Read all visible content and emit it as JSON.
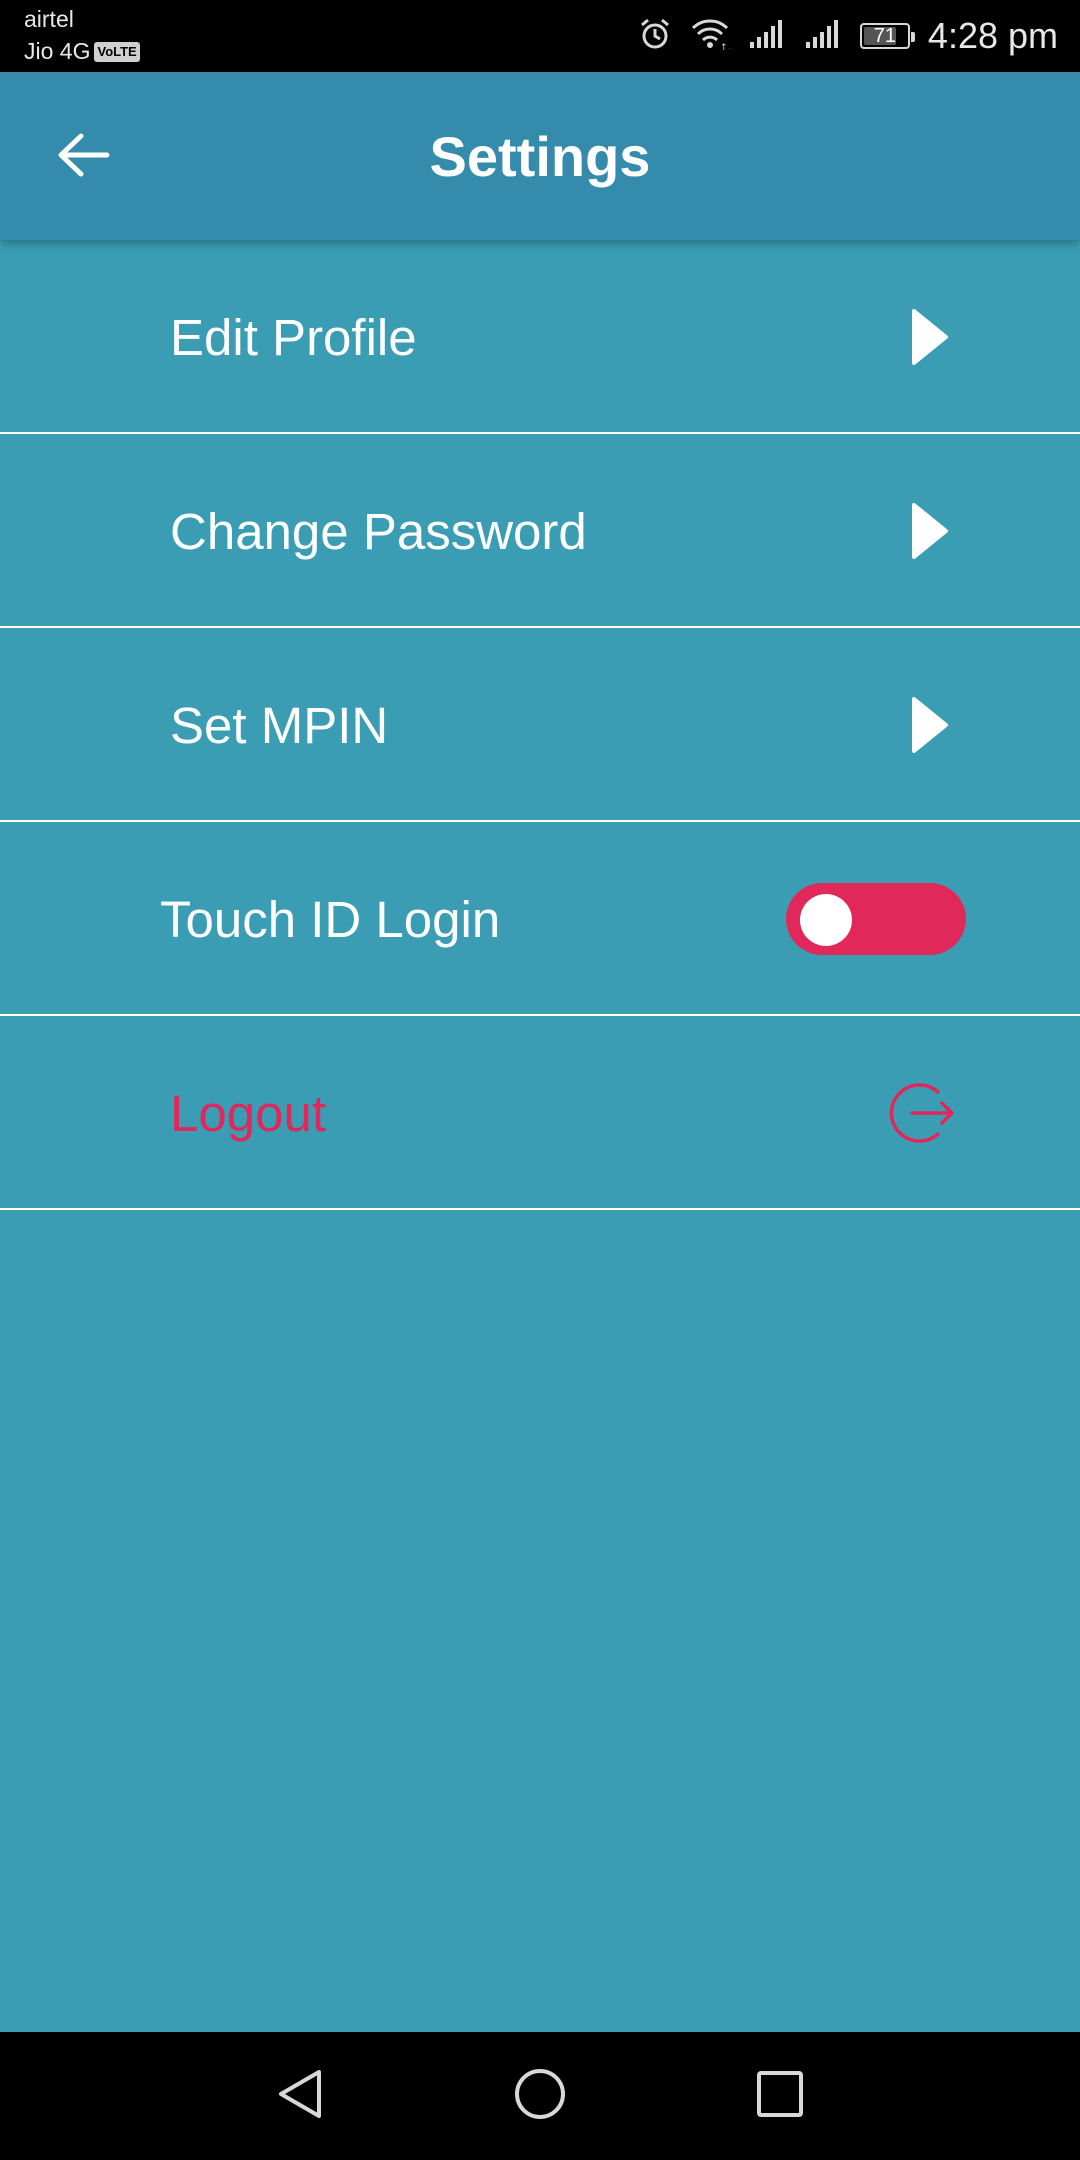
{
  "status_bar": {
    "carrier_primary": "airtel",
    "carrier_secondary": "Jio 4G",
    "volte_badge": "VoLTE",
    "battery_level": "71",
    "time": "4:28 pm",
    "icons": [
      "alarm-icon",
      "wifi-icon",
      "signal-icon",
      "signal-icon",
      "battery-icon"
    ]
  },
  "app_bar": {
    "title": "Settings",
    "back_icon": "arrow-left-icon"
  },
  "menu": {
    "edit_profile": "Edit Profile",
    "change_password": "Change Password",
    "set_mpin": "Set MPIN",
    "touch_id_login": "Touch ID Login",
    "touch_id_enabled": false,
    "logout": "Logout"
  },
  "colors": {
    "background": "#3a9db4",
    "app_bar": "#358bac",
    "accent": "#e0285a",
    "text": "#ffffff"
  },
  "nav_bar": {
    "icons": [
      "back-triangle-icon",
      "home-circle-icon",
      "recents-square-icon"
    ]
  }
}
